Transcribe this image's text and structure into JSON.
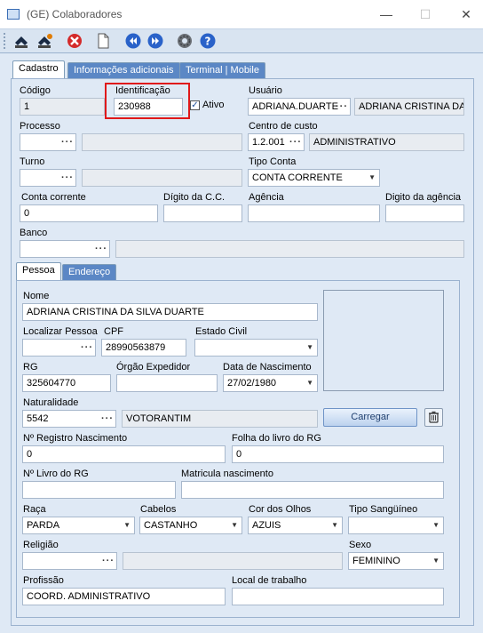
{
  "window": {
    "title": "(GE) Colaboradores",
    "minimize": "—",
    "maximize": "☐",
    "close": "✕"
  },
  "toolbar": {
    "icons": [
      "save-icon",
      "save-as-icon",
      "delete-icon",
      "new-document-icon",
      "previous-icon",
      "next-icon",
      "settings-icon",
      "help-icon"
    ]
  },
  "tabs": [
    "Cadastro",
    "Informações adicionais",
    "Terminal | Mobile"
  ],
  "fields": {
    "codigo": {
      "label": "Código",
      "value": "1"
    },
    "identificacao": {
      "label": "Identificação",
      "value": "230988"
    },
    "ativo": {
      "label": "Ativo",
      "checked": true
    },
    "usuario": {
      "label": "Usuário",
      "login": "ADRIANA.DUARTE",
      "name": "ADRIANA CRISTINA DA"
    },
    "processo": {
      "label": "Processo",
      "value": "",
      "desc": ""
    },
    "centro_custo": {
      "label": "Centro de custo",
      "code": "1.2.001",
      "desc": "ADMINISTRATIVO"
    },
    "turno": {
      "label": "Turno",
      "value": "",
      "desc": ""
    },
    "tipo_conta": {
      "label": "Tipo Conta",
      "value": "CONTA CORRENTE"
    },
    "conta_corrente": {
      "label": "Conta corrente",
      "value": "0"
    },
    "digito_cc": {
      "label": "Dígito da C.C.",
      "value": ""
    },
    "agencia": {
      "label": "Agência",
      "value": ""
    },
    "digito_agencia": {
      "label": "Digito da agência",
      "value": ""
    },
    "banco": {
      "label": "Banco",
      "value": "",
      "desc": ""
    }
  },
  "subtabs": [
    "Pessoa",
    "Endereço"
  ],
  "pessoa": {
    "nome": {
      "label": "Nome",
      "value": "ADRIANA CRISTINA DA SILVA DUARTE"
    },
    "localizar": {
      "label": "Localizar Pessoa",
      "value": ""
    },
    "cpf": {
      "label": "CPF",
      "value": "28990563879"
    },
    "estado_civil": {
      "label": "Estado Civil",
      "value": ""
    },
    "rg": {
      "label": "RG",
      "value": "325604770"
    },
    "orgao": {
      "label": "Órgão Expedidor",
      "value": ""
    },
    "nascimento": {
      "label": "Data de Nascimento",
      "value": "27/02/1980"
    },
    "naturalidade": {
      "label": "Naturalidade",
      "code": "5542",
      "city": "VOTORANTIM"
    },
    "carregar": "Carregar",
    "registro_nasc": {
      "label": "Nº Registro Nascimento",
      "value": "0"
    },
    "folha_livro": {
      "label": "Folha do livro do RG",
      "value": "0"
    },
    "livro_rg": {
      "label": "Nº Livro do RG",
      "value": ""
    },
    "matricula": {
      "label": "Matricula nascimento",
      "value": ""
    },
    "raca": {
      "label": "Raça",
      "value": "PARDA"
    },
    "cabelos": {
      "label": "Cabelos",
      "value": "CASTANHO"
    },
    "olhos": {
      "label": "Cor dos Olhos",
      "value": "AZUIS"
    },
    "sangue": {
      "label": "Tipo Sangüíneo",
      "value": ""
    },
    "religiao": {
      "label": "Religião",
      "value": "",
      "desc": ""
    },
    "sexo": {
      "label": "Sexo",
      "value": "FEMININO"
    },
    "profissao": {
      "label": "Profissão",
      "value": "COORD. ADMINISTRATIVO"
    },
    "local_trabalho": {
      "label": "Local de trabalho",
      "value": ""
    }
  },
  "colors": {
    "tab_blue": "#5b87c5",
    "panel": "#dfe9f5",
    "highlight": "#e0191a"
  }
}
